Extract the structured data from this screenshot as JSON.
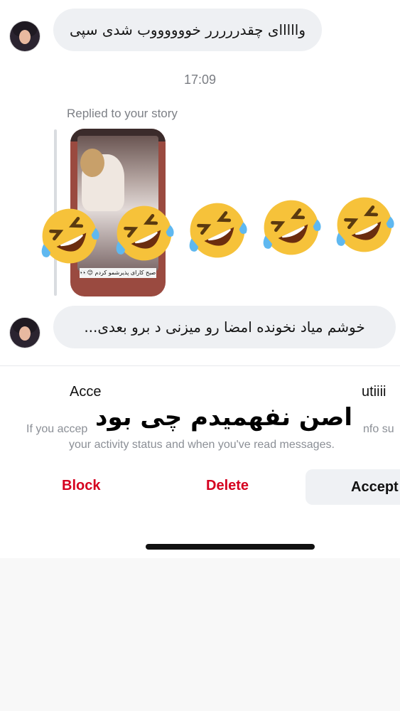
{
  "messages": [
    {
      "text": "وااااای چقدررررر خووووووب شدی سپی"
    },
    {
      "text": "خوشم میاد نخونده امضا رو میزنی د برو بعدی..."
    }
  ],
  "timestamp": "17:09",
  "story_reply": {
    "label": "Replied to your story",
    "caption": "صبح کارای پذیرشمو کردم 😊👀",
    "emoji_reaction": [
      "🤣",
      "🤣",
      "🤣",
      "🤣",
      "🤣"
    ]
  },
  "request_panel": {
    "title_left": "Acce",
    "title_right": "utiiii",
    "desc_line1_left": "If you accep",
    "desc_line1_right": "nfo su",
    "desc_line2": "your activity status and when you've read messages."
  },
  "overlay_text": "اصن نفهمیدم چی بود",
  "actions": {
    "block": "Block",
    "delete": "Delete",
    "accept": "Accept"
  },
  "colors": {
    "destructive": "#d5001f",
    "bubble": "#eef0f3"
  }
}
